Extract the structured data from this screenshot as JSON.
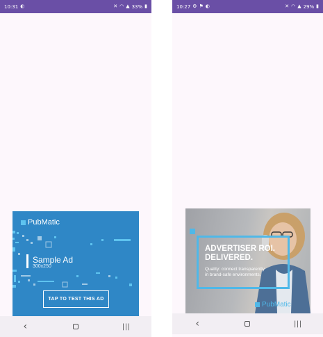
{
  "screens": [
    {
      "status": {
        "time": "10:31",
        "battery": "33%"
      },
      "ad": {
        "brand": "PubMatic",
        "title": "Sample Ad",
        "size": "300x250",
        "button": "TAP TO TEST THIS AD",
        "colors": {
          "background": "#2f87c6",
          "accent": "#5ec3ef"
        }
      }
    },
    {
      "status": {
        "time": "10:27",
        "battery": "29%"
      },
      "ad": {
        "brand": "PubMatic",
        "headline_1": "ADVERTISER ROI.",
        "headline_2": "DELIVERED.",
        "sub_1": "Quality: connect transparently",
        "sub_2": "in brand-safe environments.",
        "colors": {
          "frame": "#4fb8e8"
        }
      }
    }
  ],
  "nav": {
    "back_glyph": "‹",
    "recents_glyph": "|||"
  },
  "icons": [
    "back-icon",
    "home-icon",
    "recents-icon",
    "wifi-icon",
    "signal-icon",
    "battery-icon",
    "mute-icon"
  ],
  "theme": {
    "status_bar": "#6a4fa6",
    "screen_bg": "#fdf7fc",
    "nav_bar": "#f2eef3"
  }
}
